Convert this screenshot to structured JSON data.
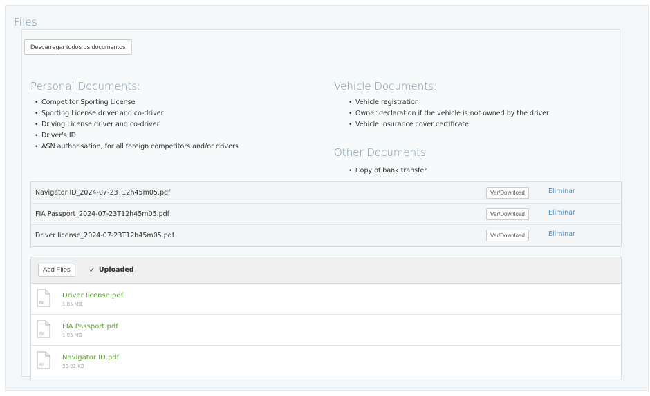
{
  "panel": {
    "title": "Files"
  },
  "download_all_label": "Descarregar todos os documentos",
  "personal": {
    "heading": "Personal Documents:",
    "items": [
      "Competitor Sporting License",
      "Sporting License driver and co-driver",
      "Driving License driver and co-driver",
      "Driver's ID",
      "ASN authorisation, for all foreign competitors and/or drivers"
    ]
  },
  "vehicle": {
    "heading": "Vehicle Documents:",
    "items": [
      "Vehicle registration",
      "Owner declaration if the vehicle is not owned by the driver",
      "Vehicle Insurance cover certificate"
    ]
  },
  "other": {
    "heading": "Other Documents",
    "items": [
      "Copy of bank transfer"
    ]
  },
  "files": [
    {
      "name": "Navigator ID_2024-07-23T12h45m05.pdf",
      "view_label": "Ver/Download",
      "delete_label": "Eliminar"
    },
    {
      "name": "FIA Passport_2024-07-23T12h45m05.pdf",
      "view_label": "Ver/Download",
      "delete_label": "Eliminar"
    },
    {
      "name": "Driver license_2024-07-23T12h45m05.pdf",
      "view_label": "Ver/Download",
      "delete_label": "Eliminar"
    }
  ],
  "uploader": {
    "add_files_label": "Add Files",
    "status_label": "Uploaded",
    "status_icon": "check-icon",
    "items": [
      {
        "name": "Driver license.pdf",
        "size": "1.05 MB",
        "type_label": "PDF"
      },
      {
        "name": "FIA Passport.pdf",
        "size": "1.05 MB",
        "type_label": "PDF"
      },
      {
        "name": "Navigator ID.pdf",
        "size": "96.82 KB",
        "type_label": "PDF"
      }
    ]
  },
  "colors": {
    "heading": "#7e95a6",
    "link_blue": "#4f8fbe",
    "file_green": "#5fa635",
    "panel_bg": "#f3f7f9"
  }
}
